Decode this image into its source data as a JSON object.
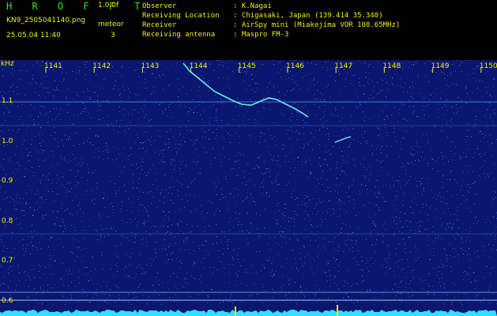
{
  "header": {
    "title": "H R O F F T",
    "version": "1.0.0f",
    "filename": "KN9_2505041140.png",
    "mode": "meteor",
    "timestamp": "25.05.04 11:40",
    "count": "3",
    "info": [
      {
        "label": "Observer",
        "value": ": K.Nagai"
      },
      {
        "label": "Receiving Location",
        "value": ": Chigasaki, Japan (139.414 35.340)"
      },
      {
        "label": "Receiver",
        "value": ": AirSpy mini (Miakejima VOR 108.65MHz)"
      },
      {
        "label": "Receiving antenna",
        "value": ": Maspro FM-3"
      }
    ]
  },
  "plot": {
    "y_unit": "kHz",
    "x_ticks": [
      "1141",
      "1142",
      "1143",
      "1144",
      "1145",
      "1146",
      "1147",
      "1148",
      "1149",
      "1150"
    ],
    "y_ticks": [
      "1.1",
      "1.0",
      "0.9",
      "0.8",
      "0.7",
      "0.6"
    ],
    "colors": {
      "background": "#0a1670",
      "text": "#f0f000",
      "trace": "#5ff0e8",
      "baseline": "#30e0ff"
    }
  }
}
